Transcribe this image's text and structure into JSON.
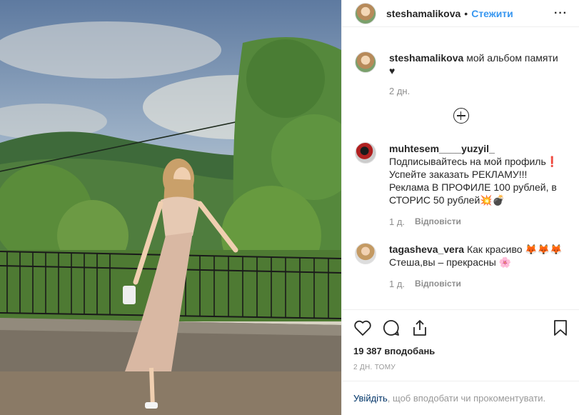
{
  "header": {
    "username": "steshamalikova",
    "separator": "•",
    "follow_label": "Стежити",
    "more_label": "···"
  },
  "caption": {
    "username": "steshamalikova",
    "text": "мой альбом памяти",
    "emoji": "♥",
    "time": "2 дн."
  },
  "comments": [
    {
      "username": "muhtesem____yuzyil_",
      "lines": [
        "Подписывайтесь на мой профиль❗",
        "Успейте заказать РЕКЛАМУ!!!",
        "Реклама В ПРОФИЛЕ 100 рублей, в",
        "СТОРИС 50 рублей💥💣"
      ],
      "time": "1 д.",
      "reply": "Відповісти"
    },
    {
      "username": "tagasheva_vera",
      "line1": "Как красиво 🦊🦊🦊",
      "line2": "Стеша,вы – прекрасны 🌸",
      "time": "1 д.",
      "reply": "Відповісти"
    }
  ],
  "likes": "19 387 вподобань",
  "post_time": "2 ДН. ТОМУ",
  "login": {
    "link": "Увійдіть",
    "text": ", щоб вподобати чи прокоментувати."
  },
  "icons": [
    "heart-icon",
    "comment-icon",
    "share-icon",
    "bookmark-icon",
    "load-more-icon"
  ]
}
